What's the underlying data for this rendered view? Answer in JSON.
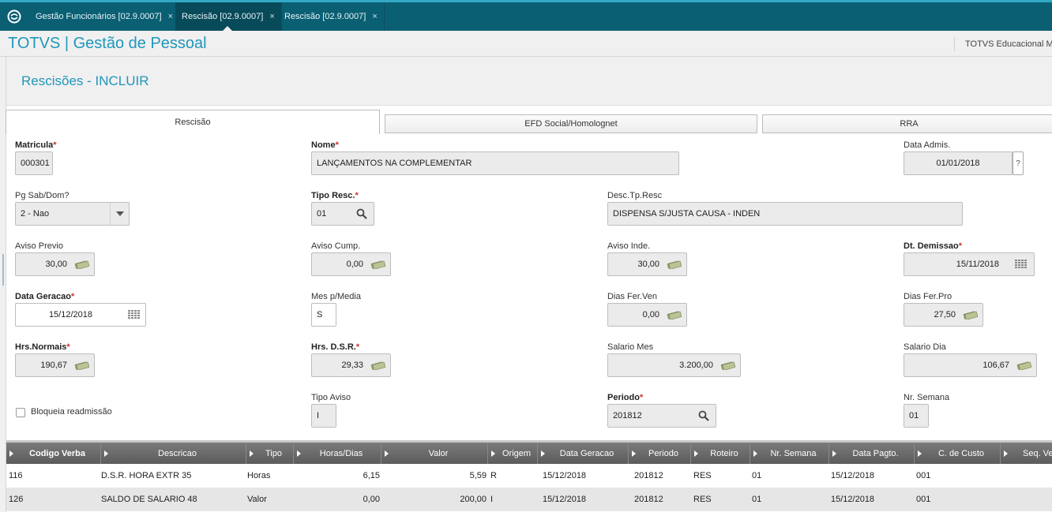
{
  "window_tabs": [
    {
      "label": "Gestão Funcionários [02.9.0007]"
    },
    {
      "label": "Rescisão [02.9.0007]"
    },
    {
      "label": "Rescisão [02.9.0007]"
    }
  ],
  "close_glyph": "×",
  "header": {
    "app_title": "TOTVS | Gestão de Pessoal",
    "company": "TOTVS Educacional MS"
  },
  "page": {
    "title": "Rescisões - INCLUIR"
  },
  "form_tabs": [
    {
      "label": "Rescisão"
    },
    {
      "label": "EFD Social/Homolognet"
    },
    {
      "label": "RRA"
    }
  ],
  "required_mark": "*",
  "fields": {
    "matricula": {
      "label": "Matricula",
      "value": "000301"
    },
    "nome": {
      "label": "Nome",
      "value": "LANÇAMENTOS NA COMPLEMENTAR"
    },
    "data_admis": {
      "label": "Data Admis.",
      "value": "01/01/2018",
      "help": "?"
    },
    "pg_sab_dom": {
      "label": "Pg Sab/Dom?",
      "value": "2 - Nao"
    },
    "tipo_resc": {
      "label": "Tipo Resc.",
      "value": "01"
    },
    "desc_tp_resc": {
      "label": "Desc.Tp.Resc",
      "value": "DISPENSA S/JUSTA CAUSA - INDEN"
    },
    "aviso_previo": {
      "label": "Aviso Previo",
      "value": "30,00"
    },
    "aviso_cump": {
      "label": "Aviso Cump.",
      "value": "0,00"
    },
    "aviso_inde": {
      "label": "Aviso Inde.",
      "value": "30,00"
    },
    "dt_demissao": {
      "label": "Dt. Demissao",
      "value": "15/11/2018"
    },
    "data_geracao": {
      "label": "Data Geracao",
      "value": "15/12/2018"
    },
    "mes_p_media": {
      "label": "Mes p/Media",
      "value": "S"
    },
    "dias_fer_ven": {
      "label": "Dias Fer.Ven",
      "value": "0,00"
    },
    "dias_fer_pro": {
      "label": "Dias Fer.Pro",
      "value": "27,50"
    },
    "hrs_normais": {
      "label": "Hrs.Normais",
      "value": "190,67"
    },
    "hrs_dsr": {
      "label": "Hrs. D.S.R.",
      "value": "29,33"
    },
    "salario_mes": {
      "label": "Salario Mes",
      "value": "3.200,00"
    },
    "salario_dia": {
      "label": "Salario Dia",
      "value": "106,67"
    },
    "bloqueia_readmissao": {
      "label": "Bloqueia readmissão",
      "checked": false
    },
    "tipo_aviso": {
      "label": "Tipo Aviso",
      "value": "I"
    },
    "periodo": {
      "label": "Periodo",
      "value": "201812"
    },
    "nr_semana": {
      "label": "Nr. Semana",
      "value": "01"
    }
  },
  "grid": {
    "columns": [
      "Codigo Verba",
      "Descricao",
      "Tipo",
      "Horas/Dias",
      "Valor",
      "Origem",
      "Data Geracao",
      "Periodo",
      "Roteiro",
      "Nr. Semana",
      "Data Pagto.",
      "C. de Custo",
      "Seq. Ver"
    ],
    "rows": [
      [
        "116",
        "D.S.R. HORA EXTR  35",
        "Horas",
        "6,15",
        "5,59",
        "R",
        "15/12/2018",
        "201812",
        "RES",
        "01",
        "15/12/2018",
        "001",
        ""
      ],
      [
        "126",
        "SALDO DE SALARIO 48",
        "Valor",
        "0,00",
        "200,00",
        "I",
        "15/12/2018",
        "201812",
        "RES",
        "01",
        "15/12/2018",
        "001",
        ""
      ]
    ]
  },
  "colors": {
    "tabbar": "#0a5f73",
    "accent": "#1f97ba",
    "required": "#d0302a"
  }
}
